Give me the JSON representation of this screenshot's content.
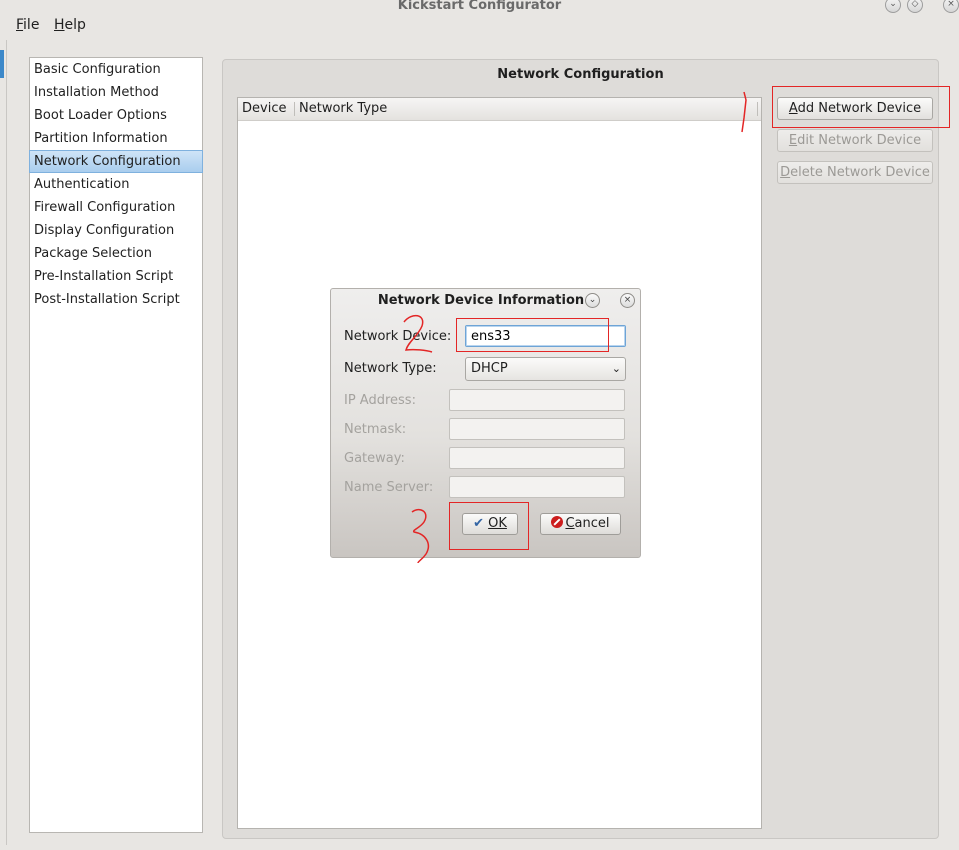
{
  "window": {
    "title": "Kickstart Configurator"
  },
  "menubar": {
    "file": "File",
    "help": "Help"
  },
  "sidebar": {
    "items": [
      {
        "label": "Basic Configuration"
      },
      {
        "label": "Installation Method"
      },
      {
        "label": "Boot Loader Options"
      },
      {
        "label": "Partition Information"
      },
      {
        "label": "Network Configuration",
        "active": true
      },
      {
        "label": "Authentication"
      },
      {
        "label": "Firewall Configuration"
      },
      {
        "label": "Display Configuration"
      },
      {
        "label": "Package Selection"
      },
      {
        "label": "Pre-Installation Script"
      },
      {
        "label": "Post-Installation Script"
      }
    ]
  },
  "main": {
    "title": "Network Configuration",
    "columns": [
      "Device",
      "Network Type"
    ],
    "buttons": {
      "add": "Add Network Device",
      "edit": "Edit Network Device",
      "delete": "Delete Network Device"
    }
  },
  "dialog": {
    "title": "Network Device Information",
    "device_label": "Network Device:",
    "device_value": "ens33",
    "type_label": "Network Type:",
    "type_value": "DHCP",
    "ip_label": "IP Address:",
    "netmask_label": "Netmask:",
    "gateway_label": "Gateway:",
    "nameserver_label": "Name Server:",
    "ok": "OK",
    "cancel": "Cancel"
  },
  "colors": {
    "annotation": "#e32626",
    "selection": "#a9cdee"
  }
}
